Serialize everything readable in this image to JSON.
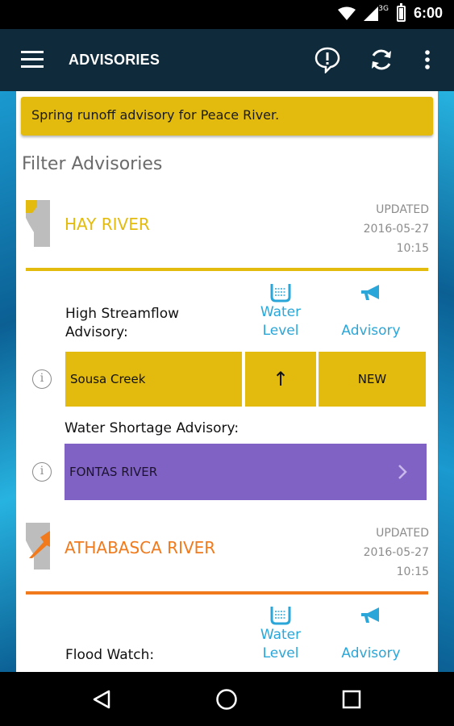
{
  "status_bar": {
    "time": "6:00",
    "network": "3G"
  },
  "app_bar": {
    "title": "ADVISORIES"
  },
  "banner": {
    "text": "Spring runoff advisory for Peace River."
  },
  "filter": {
    "title": "Filter Advisories"
  },
  "rivers": [
    {
      "name": "HAY RIVER",
      "color": "#e3bb0e",
      "updated_label": "UPDATED",
      "updated_date": "2016-05-27",
      "updated_time": "10:15",
      "columns": {
        "water_level": "Water\nLevel",
        "advisory": "Advisory"
      },
      "groups": [
        {
          "label": "High Streamflow\nAdvisory:",
          "row": {
            "name": "Sousa Creek",
            "trend": "↑",
            "status": "NEW"
          }
        },
        {
          "label": "Water Shortage Advisory:",
          "row": {
            "name": "FONTAS RIVER"
          }
        }
      ]
    },
    {
      "name": "ATHABASCA RIVER",
      "color": "#f07a1c",
      "updated_label": "UPDATED",
      "updated_date": "2016-05-27",
      "updated_time": "10:15",
      "columns": {
        "water_level": "Water\nLevel",
        "advisory": "Advisory"
      },
      "groups": [
        {
          "label": "Flood Watch:"
        }
      ]
    }
  ],
  "colors": {
    "accent_blue": "#2aa6d8",
    "app_bar": "#0f2a3a",
    "purple": "#7f62c4"
  }
}
